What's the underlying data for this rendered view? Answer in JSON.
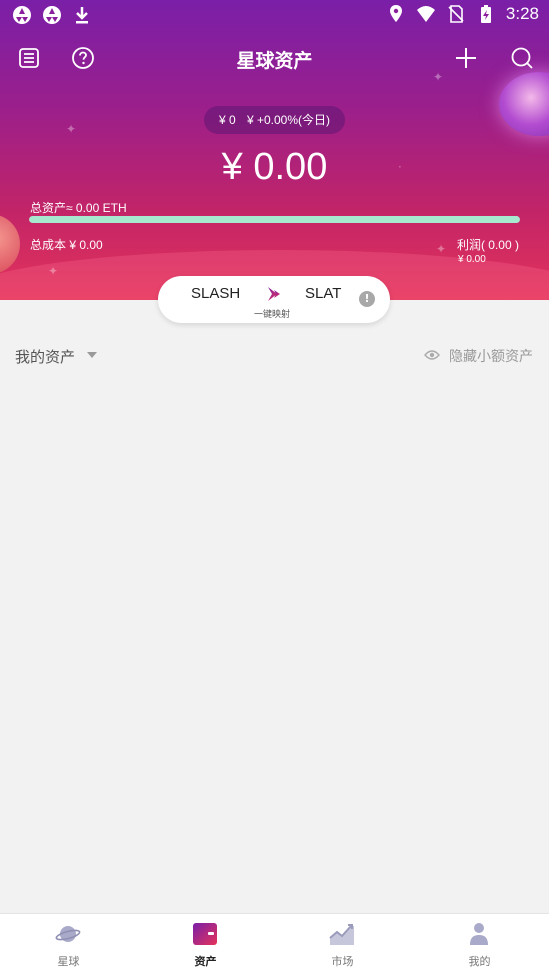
{
  "status_bar": {
    "time": "3:28",
    "left_icons": [
      "aperture-icon",
      "aperture-icon",
      "download-icon"
    ],
    "right_icons": [
      "location-icon",
      "wifi-icon",
      "no-sim-icon",
      "battery-charging-icon"
    ]
  },
  "header": {
    "title": "星球资产",
    "left_icons": [
      "list-icon",
      "help-icon"
    ],
    "right_icons": [
      "plus-icon",
      "search-icon"
    ]
  },
  "summary": {
    "pill_value": "¥ 0",
    "pill_change": "¥ +0.00%(今日)",
    "total_amount": "¥ 0.00",
    "total_assets_label": "总资产≈ 0.00 ETH",
    "progress_percent": 100,
    "progress_color": "#a6e9cf",
    "cost_label": "总成本 ¥ 0.00",
    "profit_label": "利润( 0.00 )",
    "profit_value": "¥ 0.00"
  },
  "mapping_card": {
    "from": "SLASH",
    "to": "SLAT",
    "subtitle": "一键映射",
    "info_icon": "info-icon",
    "arrow_icon": "chevron-right-icon"
  },
  "assets_section": {
    "title": "我的资产",
    "hide_small_label": "隐藏小额资产"
  },
  "tabs": [
    {
      "label": "星球",
      "icon": "planet-icon",
      "active": false
    },
    {
      "label": "资产",
      "icon": "wallet-icon",
      "active": true
    },
    {
      "label": "市场",
      "icon": "market-chart-icon",
      "active": false
    },
    {
      "label": "我的",
      "icon": "person-icon",
      "active": false
    }
  ],
  "colors": {
    "gradient_top": "#7a1fa8",
    "gradient_bottom": "#e4335a",
    "accent": "#c22468"
  }
}
